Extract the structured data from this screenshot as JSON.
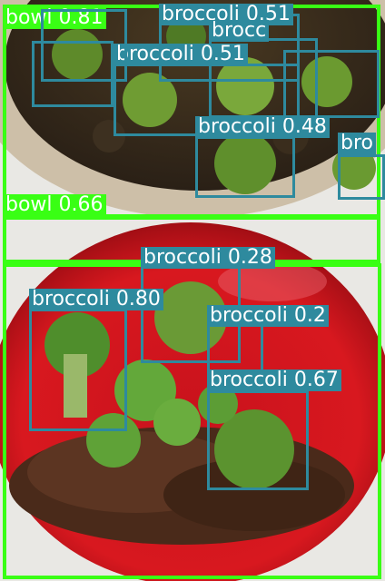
{
  "colors": {
    "bowl": "#39ff14",
    "broccoli": "#2e8a9e",
    "label_text": "#ffffff"
  },
  "detections": [
    {
      "cls": "bowl",
      "text": "bowl 0.81"
    },
    {
      "cls": "bowl",
      "text": "bowl 0.66"
    },
    {
      "cls": "bowl",
      "text": ""
    },
    {
      "cls": "broccoli",
      "text": "broccoli 0.51"
    },
    {
      "cls": "broccoli",
      "text": "brocc"
    },
    {
      "cls": "broccoli",
      "text": "broccoli 0.51"
    },
    {
      "cls": "broccoli",
      "text": "broccoli 0.48"
    },
    {
      "cls": "broccoli",
      "text": "bro"
    },
    {
      "cls": "broccoli",
      "text": "broccoli 0.28"
    },
    {
      "cls": "broccoli",
      "text": "broccoli 0.80"
    },
    {
      "cls": "broccoli",
      "text": "broccoli 0.2"
    },
    {
      "cls": "broccoli",
      "text": "broccoli 0.67"
    },
    {
      "cls": "broccoli",
      "text": ""
    },
    {
      "cls": "broccoli",
      "text": ""
    },
    {
      "cls": "broccoli",
      "text": ""
    }
  ]
}
